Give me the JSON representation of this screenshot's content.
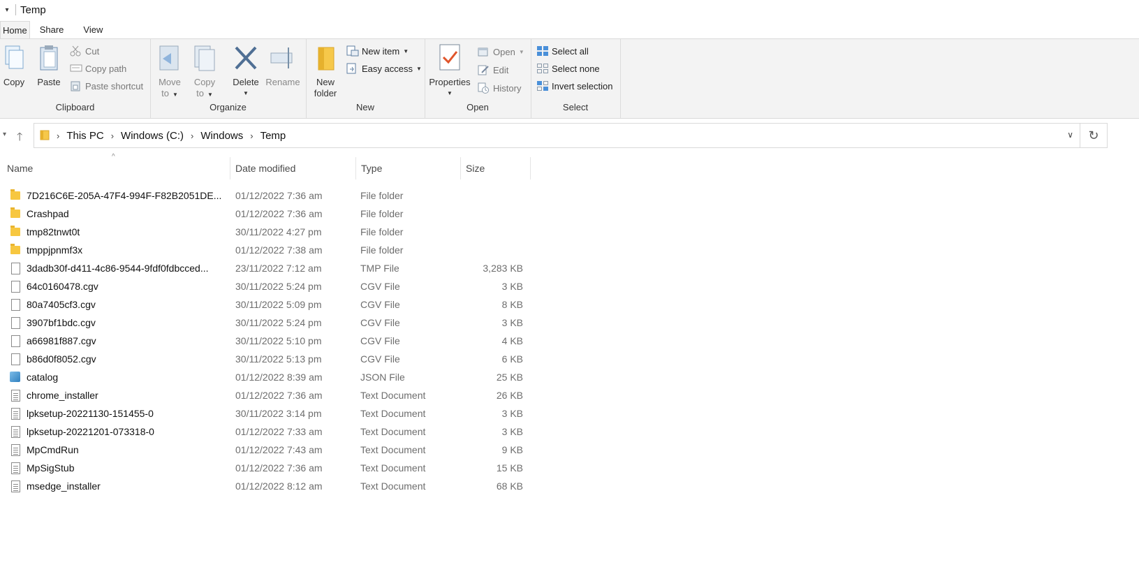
{
  "window": {
    "title": "Temp"
  },
  "tabs": [
    "Home",
    "Share",
    "View"
  ],
  "ribbon": {
    "clipboard": {
      "label": "Clipboard",
      "copy": "Copy",
      "paste": "Paste",
      "cut": "Cut",
      "copy_path": "Copy path",
      "paste_shortcut": "Paste shortcut"
    },
    "organize": {
      "label": "Organize",
      "move_to": [
        "Move",
        "to"
      ],
      "copy_to": [
        "Copy",
        "to"
      ],
      "delete": "Delete",
      "rename": "Rename"
    },
    "new": {
      "label": "New",
      "new_folder": [
        "New",
        "folder"
      ],
      "new_item": "New item",
      "easy_access": "Easy access"
    },
    "open": {
      "label": "Open",
      "properties": "Properties",
      "open": "Open",
      "edit": "Edit",
      "history": "History"
    },
    "select": {
      "label": "Select",
      "select_all": "Select all",
      "select_none": "Select none",
      "invert_selection": "Invert selection"
    }
  },
  "address": {
    "crumbs": [
      "This PC",
      "Windows (C:)",
      "Windows",
      "Temp"
    ]
  },
  "columns": {
    "name": "Name",
    "date": "Date modified",
    "type": "Type",
    "size": "Size"
  },
  "files": [
    {
      "name": "7D216C6E-205A-47F4-994F-F82B2051DE...",
      "date": "01/12/2022 7:36 am",
      "type": "File folder",
      "size": "",
      "icon": "folder"
    },
    {
      "name": "Crashpad",
      "date": "01/12/2022 7:36 am",
      "type": "File folder",
      "size": "",
      "icon": "folder"
    },
    {
      "name": "tmp82tnwt0t",
      "date": "30/11/2022 4:27 pm",
      "type": "File folder",
      "size": "",
      "icon": "folder"
    },
    {
      "name": "tmppjpnmf3x",
      "date": "01/12/2022 7:38 am",
      "type": "File folder",
      "size": "",
      "icon": "folder"
    },
    {
      "name": "3dadb30f-d411-4c86-9544-9fdf0fdbcced...",
      "date": "23/11/2022 7:12 am",
      "type": "TMP File",
      "size": "3,283 KB",
      "icon": "file"
    },
    {
      "name": "64c0160478.cgv",
      "date": "30/11/2022 5:24 pm",
      "type": "CGV File",
      "size": "3 KB",
      "icon": "file"
    },
    {
      "name": "80a7405cf3.cgv",
      "date": "30/11/2022 5:09 pm",
      "type": "CGV File",
      "size": "8 KB",
      "icon": "file"
    },
    {
      "name": "3907bf1bdc.cgv",
      "date": "30/11/2022 5:24 pm",
      "type": "CGV File",
      "size": "3 KB",
      "icon": "file"
    },
    {
      "name": "a66981f887.cgv",
      "date": "30/11/2022 5:10 pm",
      "type": "CGV File",
      "size": "4 KB",
      "icon": "file"
    },
    {
      "name": "b86d0f8052.cgv",
      "date": "30/11/2022 5:13 pm",
      "type": "CGV File",
      "size": "6 KB",
      "icon": "file"
    },
    {
      "name": "catalog",
      "date": "01/12/2022 8:39 am",
      "type": "JSON File",
      "size": "25 KB",
      "icon": "json"
    },
    {
      "name": "chrome_installer",
      "date": "01/12/2022 7:36 am",
      "type": "Text Document",
      "size": "26 KB",
      "icon": "text"
    },
    {
      "name": "lpksetup-20221130-151455-0",
      "date": "30/11/2022 3:14 pm",
      "type": "Text Document",
      "size": "3 KB",
      "icon": "text"
    },
    {
      "name": "lpksetup-20221201-073318-0",
      "date": "01/12/2022 7:33 am",
      "type": "Text Document",
      "size": "3 KB",
      "icon": "text"
    },
    {
      "name": "MpCmdRun",
      "date": "01/12/2022 7:43 am",
      "type": "Text Document",
      "size": "9 KB",
      "icon": "text"
    },
    {
      "name": "MpSigStub",
      "date": "01/12/2022 7:36 am",
      "type": "Text Document",
      "size": "15 KB",
      "icon": "text"
    },
    {
      "name": "msedge_installer",
      "date": "01/12/2022 8:12 am",
      "type": "Text Document",
      "size": "68 KB",
      "icon": "text"
    }
  ]
}
